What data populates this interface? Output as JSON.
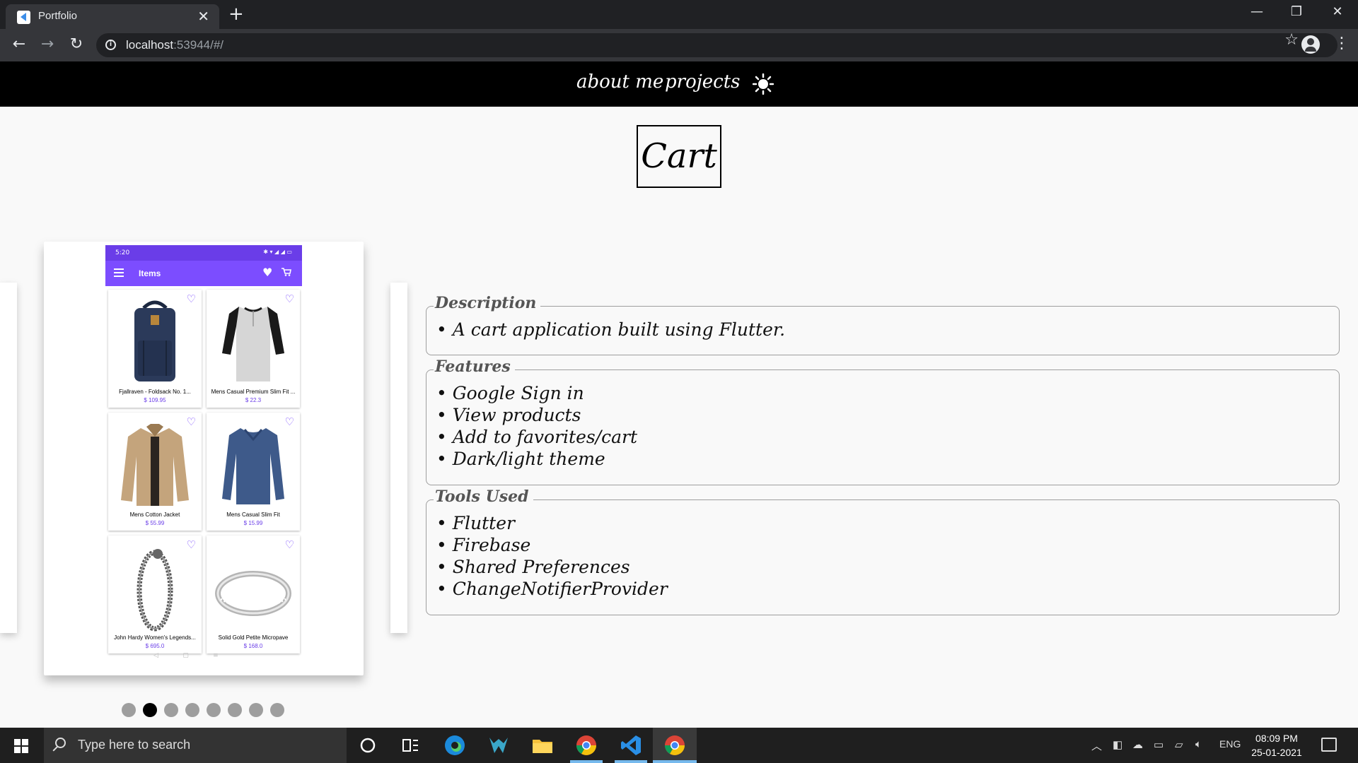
{
  "browser": {
    "tab_title": "Portfolio",
    "url_host": "localhost",
    "url_rest": ":53944/#/"
  },
  "site": {
    "nav": [
      "about me",
      "projects"
    ],
    "theme_toggle_icon": "sun-icon"
  },
  "project": {
    "title": "Cart",
    "sections": [
      {
        "heading": "Description",
        "items": [
          "• A cart application built using Flutter."
        ]
      },
      {
        "heading": "Features",
        "items": [
          "• Google Sign in",
          "• View products",
          "• Add to favorites/cart",
          "• Dark/light theme"
        ]
      },
      {
        "heading": "Tools Used",
        "items": [
          "• Flutter",
          "• Firebase",
          "• Shared Preferences",
          "• ChangeNotifierProvider"
        ]
      }
    ]
  },
  "phone": {
    "time": "5:20",
    "status_icons": "✱ ▾ ◢ ◢ ▭",
    "appbar_title": "Items",
    "products": [
      {
        "name": "Fjallraven - Foldsack No. 1...",
        "price": "$ 109.95"
      },
      {
        "name": "Mens Casual Premium Slim Fit ...",
        "price": "$ 22.3"
      },
      {
        "name": "Mens Cotton Jacket",
        "price": "$ 55.99"
      },
      {
        "name": "Mens Casual Slim Fit",
        "price": "$ 15.99"
      },
      {
        "name": "John Hardy Women's Legends...",
        "price": "$ 695.0"
      },
      {
        "name": "Solid Gold Petite Micropave",
        "price": "$ 168.0"
      }
    ],
    "navbar": "◁            ▢            ≡"
  },
  "carousel": {
    "dot_count": 8,
    "active_index": 1
  },
  "taskbar": {
    "search_placeholder": "Type here to search",
    "language": "ENG",
    "time": "08:09 PM",
    "date": "25-01-2021"
  }
}
